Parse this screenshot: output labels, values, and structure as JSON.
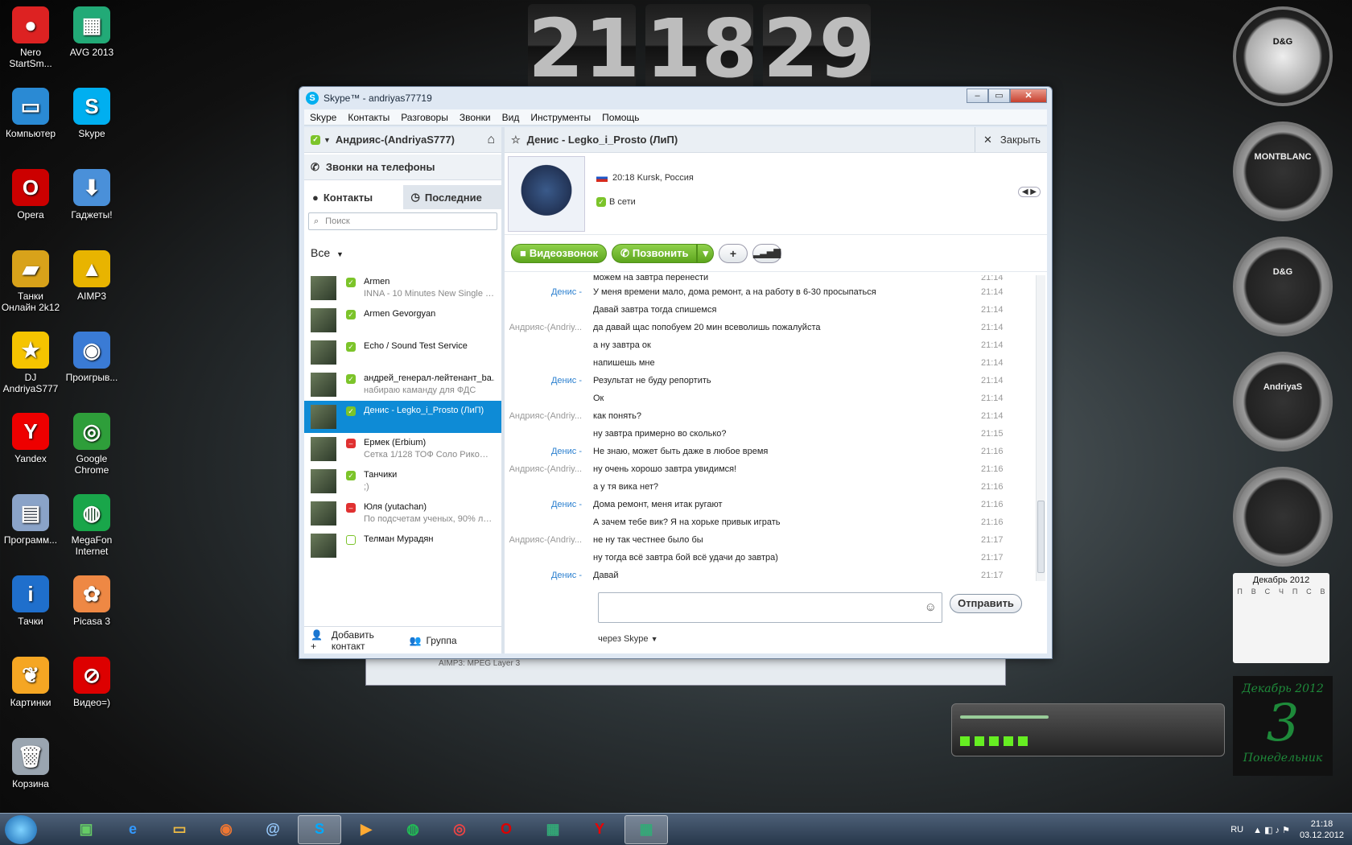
{
  "desktop": {
    "icons": [
      {
        "label": "Nero\nStartSm...",
        "color": "#d22",
        "glyph": "●"
      },
      {
        "label": "AVG 2013",
        "color": "#2a7",
        "glyph": "▦"
      },
      {
        "label": "Компьютер",
        "color": "#2a8ad4",
        "glyph": "▭"
      },
      {
        "label": "Skype",
        "color": "#00aff0",
        "glyph": "S"
      },
      {
        "label": "Opera",
        "color": "#c00",
        "glyph": "O"
      },
      {
        "label": "Гаджеты!",
        "color": "#4a90d9",
        "glyph": "⬇"
      },
      {
        "label": "Танки\nОнлайн 2k12",
        "color": "#d8a21a",
        "glyph": "▰"
      },
      {
        "label": "AIMP3",
        "color": "#e8b400",
        "glyph": "▲"
      },
      {
        "label": "DJ\nAndriyaS777",
        "color": "#f5c400",
        "glyph": "★"
      },
      {
        "label": "Проигрыв...",
        "color": "#3a7bd5",
        "glyph": "◉"
      },
      {
        "label": "Yandex",
        "color": "#e00",
        "glyph": "Y"
      },
      {
        "label": "Google\nChrome",
        "color": "#2e9e3a",
        "glyph": "◎"
      },
      {
        "label": "Программ...",
        "color": "#8aa3c8",
        "glyph": "▤"
      },
      {
        "label": "MegaFon\nInternet",
        "color": "#19a64a",
        "glyph": "◍"
      },
      {
        "label": "Тачки",
        "color": "#1f6fcc",
        "glyph": "i"
      },
      {
        "label": "Picasa 3",
        "color": "#e84",
        "glyph": "✿"
      },
      {
        "label": "Картинки",
        "color": "#f5a623",
        "glyph": "❦"
      },
      {
        "label": "Видео=)",
        "color": "#d00",
        "glyph": "⊘"
      },
      {
        "label": "Корзина",
        "color": "#9aa5b0",
        "glyph": "🗑"
      }
    ],
    "flip_clock": [
      "21",
      "18",
      "29"
    ],
    "gadget_clocks": [
      {
        "brand": "D&G",
        "style": "light"
      },
      {
        "brand": "MONTBLANC",
        "style": "dark"
      },
      {
        "brand": "D&G",
        "style": "dark"
      },
      {
        "brand": "AndriyaS",
        "style": "dark"
      },
      {
        "brand": "",
        "style": "dark"
      }
    ],
    "calendar": {
      "month": "Декабрь 2012",
      "weekdays": [
        "П",
        "В",
        "С",
        "Ч",
        "П",
        "С",
        "В"
      ]
    },
    "date_gadget": {
      "month": "Декабрь 2012",
      "day": "3",
      "weekday": "Понедельник"
    },
    "behind_window_text": "AIMP3: MPEG Layer 3"
  },
  "skype": {
    "title": "Skype™ - andriyas77719",
    "menu": [
      "Skype",
      "Контакты",
      "Разговоры",
      "Звонки",
      "Вид",
      "Инструменты",
      "Помощь"
    ],
    "me": "Андрияс-(AndriyaS777)",
    "call_phones": "Звонки на телефоны",
    "tabs": [
      "Контакты",
      "Последние"
    ],
    "search_placeholder": "Поиск",
    "filter": "Все",
    "contacts": [
      {
        "name": "Armen",
        "mood": "INNA - 10 Minutes New Single (R...",
        "status": "online",
        "selected": false
      },
      {
        "name": "Armen Gevorgyan",
        "mood": "",
        "status": "online",
        "selected": false
      },
      {
        "name": "Echo / Sound Test Service",
        "mood": "",
        "status": "online",
        "selected": false
      },
      {
        "name": "андрей_генерал-лейтенант_ba...",
        "mood": "набираю каманду для ФДС",
        "status": "online",
        "selected": false
      },
      {
        "name": "Денис - Legko_i_Prosto (ЛиП)",
        "mood": "",
        "status": "online",
        "selected": true
      },
      {
        "name": "Ермек (Erbium)",
        "mood": "Сетка 1/128 ТОФ Соло Рикоше...",
        "status": "busy",
        "selected": false
      },
      {
        "name": "Танчики",
        "mood": ";)",
        "status": "online",
        "selected": false
      },
      {
        "name": "Юля (yutachan)",
        "mood": "По подсчетам ученых, 90% лю...",
        "status": "busy",
        "selected": false
      },
      {
        "name": "Телман Мурадян",
        "mood": "",
        "status": "offline",
        "selected": false
      }
    ],
    "add_contact": "Добавить контакт",
    "group": "Группа",
    "conversation": {
      "title": "Денис - Legko_i_Prosto (ЛиП)",
      "close": "Закрыть",
      "location": "20:18 Kursk, Россия",
      "status": "В сети",
      "video_call": "Видеозвонок",
      "call": "Позвонить",
      "messages": [
        {
          "who": "",
          "text": "можем на завтра перенести",
          "time": "21:14",
          "me": false
        },
        {
          "who": "Денис -",
          "text": "У меня времени мало, дома ремонт, а на работу в 6-30 просыпаться",
          "time": "21:14",
          "me": false
        },
        {
          "who": "",
          "text": "Давай завтра тогда спишемся",
          "time": "21:14",
          "me": false
        },
        {
          "who": "Андрияс-(Andriy...",
          "text": "да давай щас попобуем 20 мин всеволишь пожалуйста",
          "time": "21:14",
          "me": true
        },
        {
          "who": "",
          "text": "а ну завтра ок",
          "time": "21:14",
          "me": true
        },
        {
          "who": "",
          "text": "напишешь мне",
          "time": "21:14",
          "me": true
        },
        {
          "who": "Денис -",
          "text": "Результат не буду репортить",
          "time": "21:14",
          "me": false
        },
        {
          "who": "",
          "text": "Ок",
          "time": "21:14",
          "me": false
        },
        {
          "who": "Андрияс-(Andriy...",
          "text": "как понять?",
          "time": "21:14",
          "me": true
        },
        {
          "who": "",
          "text": "ну завтра примерно во сколько?",
          "time": "21:15",
          "me": true
        },
        {
          "who": "Денис -",
          "text": "Не знаю, может быть даже в любое время",
          "time": "21:16",
          "me": false
        },
        {
          "who": "Андрияс-(Andriy...",
          "text": "ну очень хорошо завтра увидимся!",
          "time": "21:16",
          "me": true
        },
        {
          "who": "",
          "text": "а у тя вика нет?",
          "time": "21:16",
          "me": true
        },
        {
          "who": "Денис -",
          "text": "Дома ремонт, меня итак ругают",
          "time": "21:16",
          "me": false
        },
        {
          "who": "",
          "text": "А зачем тебе вик? Я на хорьке привык играть",
          "time": "21:16",
          "me": false
        },
        {
          "who": "Андрияс-(Andriy...",
          "text": "не ну так честнее было бы",
          "time": "21:17",
          "me": true
        },
        {
          "who": "",
          "text": "ну тогда всё завтра бой всё удачи до завтра)",
          "time": "21:17",
          "me": true
        },
        {
          "who": "Денис -",
          "text": "Давай",
          "time": "21:17",
          "me": false
        }
      ],
      "send": "Отправить",
      "via": "через Skype"
    }
  },
  "taskbar": {
    "lang": "RU",
    "time": "21:18",
    "date": "03.12.2012",
    "apps": [
      {
        "glyph": "▣",
        "color": "#6c6"
      },
      {
        "glyph": "e",
        "color": "#39f"
      },
      {
        "glyph": "▭",
        "color": "#eb4"
      },
      {
        "glyph": "◉",
        "color": "#e73"
      },
      {
        "glyph": "@",
        "color": "#9cf"
      },
      {
        "glyph": "S",
        "color": "#0af",
        "active": true
      },
      {
        "glyph": "▶",
        "color": "#fa3"
      },
      {
        "glyph": "◍",
        "color": "#2b5"
      },
      {
        "glyph": "◎",
        "color": "#e44"
      },
      {
        "glyph": "O",
        "color": "#d00"
      },
      {
        "glyph": "▦",
        "color": "#3a7"
      },
      {
        "glyph": "Y",
        "color": "#e00"
      },
      {
        "glyph": "▦",
        "color": "#3a7",
        "active": true
      }
    ]
  }
}
